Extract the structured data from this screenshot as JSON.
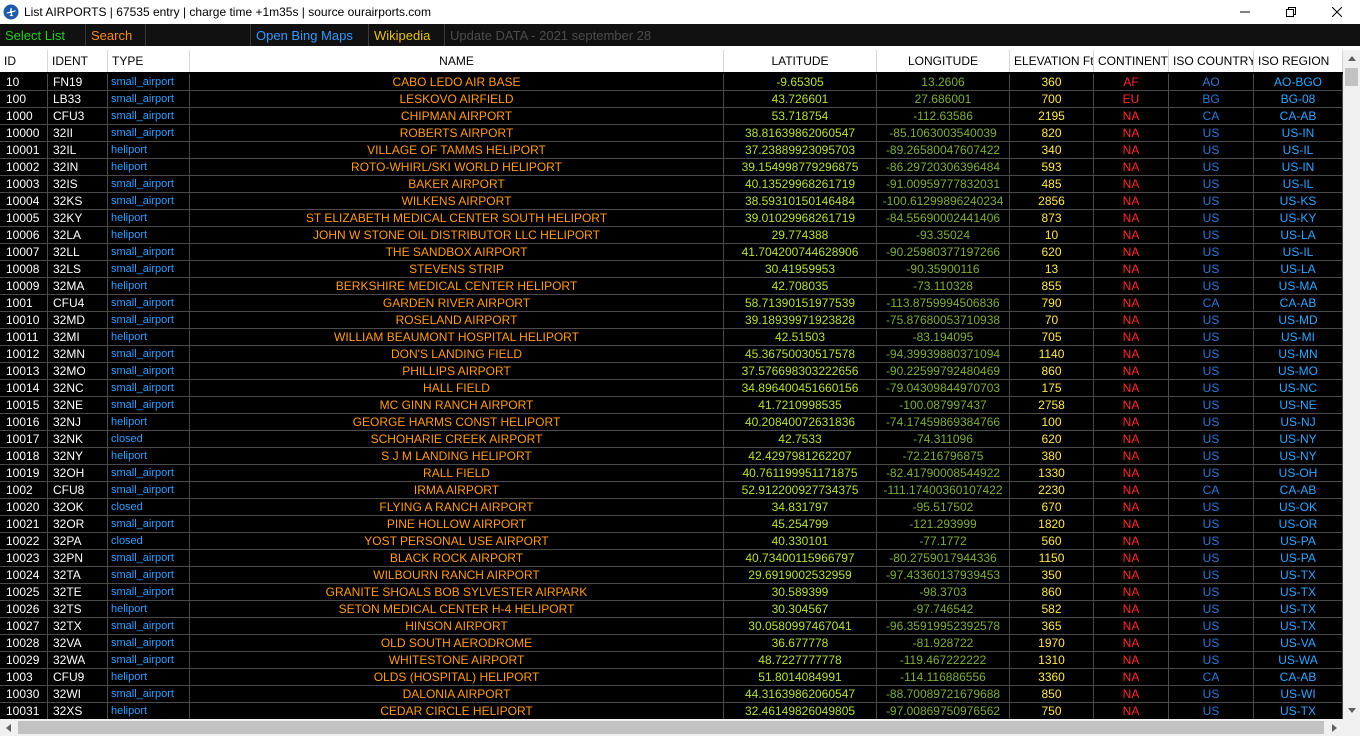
{
  "window": {
    "title": "List AIRPORTS | 67535 entry  | charge time +1m35s  | source ourairports.com",
    "app_icon": "airplane-icon",
    "controls": [
      "minimize-icon",
      "maximize-icon",
      "close-icon"
    ]
  },
  "menu": {
    "select_list": "Select List",
    "search": "Search",
    "open_bing": "Open Bing Maps",
    "wikipedia": "Wikipedia",
    "update": "Update DATA - 2021 september 28"
  },
  "colors": {
    "name": "#ff9b1e",
    "type": "#2f9fff",
    "latitude": "#b6e03a",
    "longitude": "#7fae3a",
    "elevation": "#ffe64d",
    "continent": "#ff2a2a",
    "country": "#2f78d8",
    "region": "#2fa6ff"
  },
  "columns": [
    "ID",
    "IDENT",
    "TYPE",
    "NAME",
    "LATITUDE",
    "LONGITUDE",
    "ELEVATION Ft",
    "CONTINENT",
    "ISO COUNTRY",
    "ISO REGION"
  ],
  "rows": [
    [
      "10",
      "FN19",
      "small_airport",
      "CABO LEDO AIR BASE",
      "-9.65305",
      "13.2606",
      "360",
      "AF",
      "AO",
      "AO-BGO"
    ],
    [
      "100",
      "LB33",
      "small_airport",
      "LESKOVO AIRFIELD",
      "43.726601",
      "27.686001",
      "700",
      "EU",
      "BG",
      "BG-08"
    ],
    [
      "1000",
      "CFU3",
      "small_airport",
      "CHIPMAN AIRPORT",
      "53.718754",
      "-112.63586",
      "2195",
      "NA",
      "CA",
      "CA-AB"
    ],
    [
      "10000",
      "32II",
      "small_airport",
      "ROBERTS AIRPORT",
      "38.81639862060547",
      "-85.1063003540039",
      "820",
      "NA",
      "US",
      "US-IN"
    ],
    [
      "10001",
      "32IL",
      "heliport",
      "VILLAGE OF TAMMS HELIPORT",
      "37.23889923095703",
      "-89.26580047607422",
      "340",
      "NA",
      "US",
      "US-IL"
    ],
    [
      "10002",
      "32IN",
      "heliport",
      "ROTO-WHIRL/SKI WORLD HELIPORT",
      "39.154998779296875",
      "-86.29720306396484",
      "593",
      "NA",
      "US",
      "US-IN"
    ],
    [
      "10003",
      "32IS",
      "small_airport",
      "BAKER AIRPORT",
      "40.13529968261719",
      "-91.00959777832031",
      "485",
      "NA",
      "US",
      "US-IL"
    ],
    [
      "10004",
      "32KS",
      "small_airport",
      "WILKENS AIRPORT",
      "38.59310150146484",
      "-100.61299896240234",
      "2856",
      "NA",
      "US",
      "US-KS"
    ],
    [
      "10005",
      "32KY",
      "heliport",
      "ST ELIZABETH MEDICAL CENTER SOUTH HELIPORT",
      "39.01029968261719",
      "-84.55690002441406",
      "873",
      "NA",
      "US",
      "US-KY"
    ],
    [
      "10006",
      "32LA",
      "heliport",
      "JOHN W STONE OIL DISTRIBUTOR LLC HELIPORT",
      "29.774388",
      "-93.35024",
      "10",
      "NA",
      "US",
      "US-LA"
    ],
    [
      "10007",
      "32LL",
      "small_airport",
      "THE SANDBOX AIRPORT",
      "41.704200744628906",
      "-90.25980377197266",
      "620",
      "NA",
      "US",
      "US-IL"
    ],
    [
      "10008",
      "32LS",
      "small_airport",
      "STEVENS STRIP",
      "30.41959953",
      "-90.35900116",
      "13",
      "NA",
      "US",
      "US-LA"
    ],
    [
      "10009",
      "32MA",
      "heliport",
      "BERKSHIRE MEDICAL CENTER HELIPORT",
      "42.708035",
      "-73.110328",
      "855",
      "NA",
      "US",
      "US-MA"
    ],
    [
      "1001",
      "CFU4",
      "small_airport",
      "GARDEN RIVER AIRPORT",
      "58.71390151977539",
      "-113.8759994506836",
      "790",
      "NA",
      "CA",
      "CA-AB"
    ],
    [
      "10010",
      "32MD",
      "small_airport",
      "ROSELAND AIRPORT",
      "39.18939971923828",
      "-75.87680053710938",
      "70",
      "NA",
      "US",
      "US-MD"
    ],
    [
      "10011",
      "32MI",
      "heliport",
      "WILLIAM BEAUMONT HOSPITAL HELIPORT",
      "42.51503",
      "-83.194095",
      "705",
      "NA",
      "US",
      "US-MI"
    ],
    [
      "10012",
      "32MN",
      "small_airport",
      "DON'S LANDING FIELD",
      "45.36750030517578",
      "-94.39939880371094",
      "1140",
      "NA",
      "US",
      "US-MN"
    ],
    [
      "10013",
      "32MO",
      "small_airport",
      "PHILLIPS AIRPORT",
      "37.576698303222656",
      "-90.22599792480469",
      "860",
      "NA",
      "US",
      "US-MO"
    ],
    [
      "10014",
      "32NC",
      "small_airport",
      "HALL FIELD",
      "34.896400451660156",
      "-79.04309844970703",
      "175",
      "NA",
      "US",
      "US-NC"
    ],
    [
      "10015",
      "32NE",
      "small_airport",
      "MC GINN RANCH AIRPORT",
      "41.7210998535",
      "-100.087997437",
      "2758",
      "NA",
      "US",
      "US-NE"
    ],
    [
      "10016",
      "32NJ",
      "heliport",
      "GEORGE HARMS CONST HELIPORT",
      "40.20840072631836",
      "-74.17459869384766",
      "100",
      "NA",
      "US",
      "US-NJ"
    ],
    [
      "10017",
      "32NK",
      "closed",
      "SCHOHARIE CREEK AIRPORT",
      "42.7533",
      "-74.311096",
      "620",
      "NA",
      "US",
      "US-NY"
    ],
    [
      "10018",
      "32NY",
      "heliport",
      "S J M LANDING HELIPORT",
      "42.4297981262207",
      "-72.216796875",
      "380",
      "NA",
      "US",
      "US-NY"
    ],
    [
      "10019",
      "32OH",
      "small_airport",
      "RALL FIELD",
      "40.761199951171875",
      "-82.41790008544922",
      "1330",
      "NA",
      "US",
      "US-OH"
    ],
    [
      "1002",
      "CFU8",
      "small_airport",
      "IRMA AIRPORT",
      "52.912200927734375",
      "-111.17400360107422",
      "2230",
      "NA",
      "CA",
      "CA-AB"
    ],
    [
      "10020",
      "32OK",
      "closed",
      "FLYING A RANCH AIRPORT",
      "34.831797",
      "-95.517502",
      "670",
      "NA",
      "US",
      "US-OK"
    ],
    [
      "10021",
      "32OR",
      "small_airport",
      "PINE HOLLOW AIRPORT",
      "45.254799",
      "-121.293999",
      "1820",
      "NA",
      "US",
      "US-OR"
    ],
    [
      "10022",
      "32PA",
      "closed",
      "YOST PERSONAL USE AIRPORT",
      "40.330101",
      "-77.1772",
      "560",
      "NA",
      "US",
      "US-PA"
    ],
    [
      "10023",
      "32PN",
      "small_airport",
      "BLACK ROCK AIRPORT",
      "40.73400115966797",
      "-80.2759017944336",
      "1150",
      "NA",
      "US",
      "US-PA"
    ],
    [
      "10024",
      "32TA",
      "small_airport",
      "WILBOURN RANCH AIRPORT",
      "29.6919002532959",
      "-97.43360137939453",
      "350",
      "NA",
      "US",
      "US-TX"
    ],
    [
      "10025",
      "32TE",
      "small_airport",
      "GRANITE SHOALS BOB SYLVESTER AIRPARK",
      "30.589399",
      "-98.3703",
      "860",
      "NA",
      "US",
      "US-TX"
    ],
    [
      "10026",
      "32TS",
      "heliport",
      "SETON MEDICAL CENTER H-4 HELIPORT",
      "30.304567",
      "-97.746542",
      "582",
      "NA",
      "US",
      "US-TX"
    ],
    [
      "10027",
      "32TX",
      "small_airport",
      "HINSON AIRPORT",
      "30.0580997467041",
      "-96.35919952392578",
      "365",
      "NA",
      "US",
      "US-TX"
    ],
    [
      "10028",
      "32VA",
      "small_airport",
      "OLD SOUTH AERODROME",
      "36.677778",
      "-81.928722",
      "1970",
      "NA",
      "US",
      "US-VA"
    ],
    [
      "10029",
      "32WA",
      "small_airport",
      "WHITESTONE AIRPORT",
      "48.7227777778",
      "-119.467222222",
      "1310",
      "NA",
      "US",
      "US-WA"
    ],
    [
      "1003",
      "CFU9",
      "heliport",
      "OLDS (HOSPITAL) HELIPORT",
      "51.8014084991",
      "-114.116886556",
      "3360",
      "NA",
      "CA",
      "CA-AB"
    ],
    [
      "10030",
      "32WI",
      "small_airport",
      "DALONIA AIRPORT",
      "44.31639862060547",
      "-88.70089721679688",
      "850",
      "NA",
      "US",
      "US-WI"
    ],
    [
      "10031",
      "32XS",
      "heliport",
      "CEDAR CIRCLE HELIPORT",
      "32.46149826049805",
      "-97.00869750976562",
      "750",
      "NA",
      "US",
      "US-TX"
    ]
  ]
}
